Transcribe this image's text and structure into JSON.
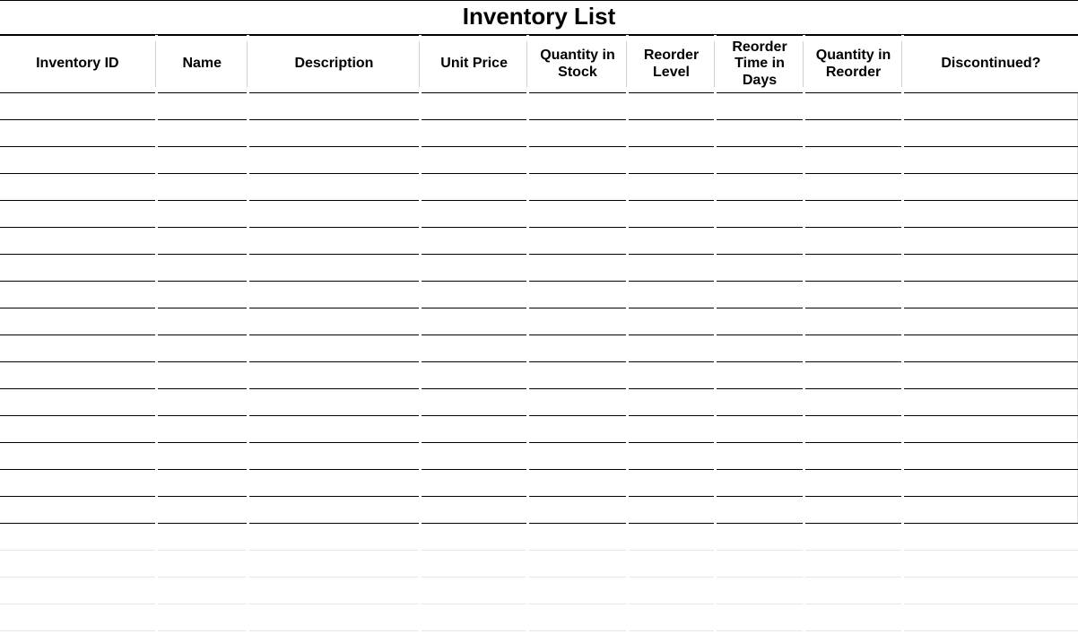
{
  "title": "Inventory List",
  "columns": [
    {
      "key": "inventory_id",
      "label": "Inventory ID"
    },
    {
      "key": "name",
      "label": "Name"
    },
    {
      "key": "description",
      "label": "Description"
    },
    {
      "key": "unit_price",
      "label": "Unit Price"
    },
    {
      "key": "quantity_in_stock",
      "label": "Quantity in Stock"
    },
    {
      "key": "reorder_level",
      "label": "Reorder Level"
    },
    {
      "key": "reorder_time_in_days",
      "label": "Reorder Time in Days"
    },
    {
      "key": "quantity_in_reorder",
      "label": "Quantity in Reorder"
    },
    {
      "key": "discontinued",
      "label": "Discontinued?"
    }
  ],
  "rows": [
    {
      "inventory_id": "",
      "name": "",
      "description": "",
      "unit_price": "",
      "quantity_in_stock": "",
      "reorder_level": "",
      "reorder_time_in_days": "",
      "quantity_in_reorder": "",
      "discontinued": ""
    },
    {
      "inventory_id": "",
      "name": "",
      "description": "",
      "unit_price": "",
      "quantity_in_stock": "",
      "reorder_level": "",
      "reorder_time_in_days": "",
      "quantity_in_reorder": "",
      "discontinued": ""
    },
    {
      "inventory_id": "",
      "name": "",
      "description": "",
      "unit_price": "",
      "quantity_in_stock": "",
      "reorder_level": "",
      "reorder_time_in_days": "",
      "quantity_in_reorder": "",
      "discontinued": ""
    },
    {
      "inventory_id": "",
      "name": "",
      "description": "",
      "unit_price": "",
      "quantity_in_stock": "",
      "reorder_level": "",
      "reorder_time_in_days": "",
      "quantity_in_reorder": "",
      "discontinued": ""
    },
    {
      "inventory_id": "",
      "name": "",
      "description": "",
      "unit_price": "",
      "quantity_in_stock": "",
      "reorder_level": "",
      "reorder_time_in_days": "",
      "quantity_in_reorder": "",
      "discontinued": ""
    },
    {
      "inventory_id": "",
      "name": "",
      "description": "",
      "unit_price": "",
      "quantity_in_stock": "",
      "reorder_level": "",
      "reorder_time_in_days": "",
      "quantity_in_reorder": "",
      "discontinued": ""
    },
    {
      "inventory_id": "",
      "name": "",
      "description": "",
      "unit_price": "",
      "quantity_in_stock": "",
      "reorder_level": "",
      "reorder_time_in_days": "",
      "quantity_in_reorder": "",
      "discontinued": ""
    },
    {
      "inventory_id": "",
      "name": "",
      "description": "",
      "unit_price": "",
      "quantity_in_stock": "",
      "reorder_level": "",
      "reorder_time_in_days": "",
      "quantity_in_reorder": "",
      "discontinued": ""
    },
    {
      "inventory_id": "",
      "name": "",
      "description": "",
      "unit_price": "",
      "quantity_in_stock": "",
      "reorder_level": "",
      "reorder_time_in_days": "",
      "quantity_in_reorder": "",
      "discontinued": ""
    },
    {
      "inventory_id": "",
      "name": "",
      "description": "",
      "unit_price": "",
      "quantity_in_stock": "",
      "reorder_level": "",
      "reorder_time_in_days": "",
      "quantity_in_reorder": "",
      "discontinued": ""
    },
    {
      "inventory_id": "",
      "name": "",
      "description": "",
      "unit_price": "",
      "quantity_in_stock": "",
      "reorder_level": "",
      "reorder_time_in_days": "",
      "quantity_in_reorder": "",
      "discontinued": ""
    },
    {
      "inventory_id": "",
      "name": "",
      "description": "",
      "unit_price": "",
      "quantity_in_stock": "",
      "reorder_level": "",
      "reorder_time_in_days": "",
      "quantity_in_reorder": "",
      "discontinued": ""
    },
    {
      "inventory_id": "",
      "name": "",
      "description": "",
      "unit_price": "",
      "quantity_in_stock": "",
      "reorder_level": "",
      "reorder_time_in_days": "",
      "quantity_in_reorder": "",
      "discontinued": ""
    },
    {
      "inventory_id": "",
      "name": "",
      "description": "",
      "unit_price": "",
      "quantity_in_stock": "",
      "reorder_level": "",
      "reorder_time_in_days": "",
      "quantity_in_reorder": "",
      "discontinued": ""
    },
    {
      "inventory_id": "",
      "name": "",
      "description": "",
      "unit_price": "",
      "quantity_in_stock": "",
      "reorder_level": "",
      "reorder_time_in_days": "",
      "quantity_in_reorder": "",
      "discontinued": ""
    },
    {
      "inventory_id": "",
      "name": "",
      "description": "",
      "unit_price": "",
      "quantity_in_stock": "",
      "reorder_level": "",
      "reorder_time_in_days": "",
      "quantity_in_reorder": "",
      "discontinued": ""
    }
  ],
  "extra_row_count": 4
}
